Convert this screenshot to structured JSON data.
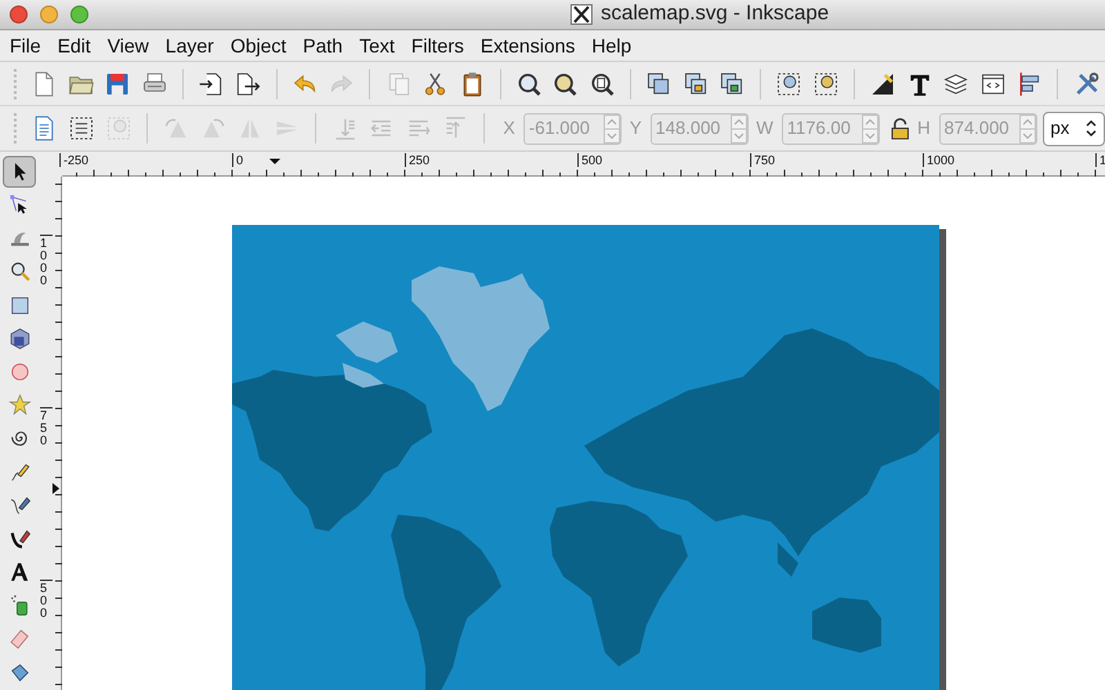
{
  "window": {
    "title": "scalemap.svg - Inkscape"
  },
  "menu": [
    {
      "label": "File"
    },
    {
      "label": "Edit"
    },
    {
      "label": "View"
    },
    {
      "label": "Layer"
    },
    {
      "label": "Object"
    },
    {
      "label": "Path"
    },
    {
      "label": "Text"
    },
    {
      "label": "Filters"
    },
    {
      "label": "Extensions"
    },
    {
      "label": "Help"
    }
  ],
  "commands_bar": [
    {
      "kind": "new",
      "disabled": false
    },
    {
      "kind": "open",
      "disabled": false
    },
    {
      "kind": "save",
      "disabled": false
    },
    {
      "kind": "print",
      "disabled": false
    },
    {
      "kind": "sep"
    },
    {
      "kind": "import",
      "disabled": false
    },
    {
      "kind": "export",
      "disabled": false
    },
    {
      "kind": "sep"
    },
    {
      "kind": "undo",
      "disabled": false
    },
    {
      "kind": "redo",
      "disabled": true
    },
    {
      "kind": "sep"
    },
    {
      "kind": "copy",
      "disabled": true
    },
    {
      "kind": "cut",
      "disabled": false
    },
    {
      "kind": "paste",
      "disabled": false
    },
    {
      "kind": "sep"
    },
    {
      "kind": "zoom-selection",
      "disabled": false
    },
    {
      "kind": "zoom-drawing",
      "disabled": false
    },
    {
      "kind": "zoom-page",
      "disabled": false
    },
    {
      "kind": "sep"
    },
    {
      "kind": "duplicate",
      "disabled": false
    },
    {
      "kind": "clone",
      "disabled": false
    },
    {
      "kind": "unlink",
      "disabled": false
    },
    {
      "kind": "sep"
    },
    {
      "kind": "group",
      "disabled": false
    },
    {
      "kind": "ungroup",
      "disabled": false
    },
    {
      "kind": "sep"
    },
    {
      "kind": "fill-stroke",
      "disabled": false
    },
    {
      "kind": "text",
      "disabled": false
    },
    {
      "kind": "layers",
      "disabled": false
    },
    {
      "kind": "xml",
      "disabled": false
    },
    {
      "kind": "align",
      "disabled": false
    },
    {
      "kind": "sep"
    },
    {
      "kind": "preferences",
      "disabled": false
    }
  ],
  "select_bar": {
    "buttons": [
      {
        "kind": "select-all",
        "disabled": false
      },
      {
        "kind": "select-all-layers",
        "disabled": false
      },
      {
        "kind": "deselect",
        "disabled": true
      },
      {
        "kind": "sep"
      },
      {
        "kind": "rotate-ccw",
        "disabled": true
      },
      {
        "kind": "rotate-cw",
        "disabled": true
      },
      {
        "kind": "flip-h",
        "disabled": true
      },
      {
        "kind": "flip-v",
        "disabled": true
      },
      {
        "kind": "sep"
      },
      {
        "kind": "to-bottom",
        "disabled": true
      },
      {
        "kind": "lower",
        "disabled": true
      },
      {
        "kind": "raise",
        "disabled": true
      },
      {
        "kind": "to-top",
        "disabled": true
      },
      {
        "kind": "sep"
      }
    ],
    "fields": [
      {
        "label": "X",
        "value": "-61.000",
        "disabled": true
      },
      {
        "label": "Y",
        "value": "148.000",
        "disabled": true
      },
      {
        "label": "W",
        "value": "1176.00",
        "disabled": true,
        "lock": true
      },
      {
        "label": "H",
        "value": "874.000",
        "disabled": true
      }
    ],
    "unit": "px"
  },
  "ruler_horizontal": [
    "-250",
    "0",
    "250",
    "500",
    "750",
    "1000",
    "1"
  ],
  "ruler_vertical": [
    "1000",
    "750",
    "500"
  ],
  "tools": [
    {
      "kind": "select",
      "selected": true
    },
    {
      "kind": "node",
      "selected": false
    },
    {
      "kind": "tweak",
      "selected": false
    },
    {
      "kind": "zoom",
      "selected": false
    },
    {
      "kind": "rect",
      "selected": false
    },
    {
      "kind": "box3d",
      "selected": false
    },
    {
      "kind": "ellipse",
      "selected": false
    },
    {
      "kind": "star",
      "selected": false
    },
    {
      "kind": "spiral",
      "selected": false
    },
    {
      "kind": "pencil",
      "selected": false
    },
    {
      "kind": "pen",
      "selected": false
    },
    {
      "kind": "calligraphy",
      "selected": false
    },
    {
      "kind": "text",
      "selected": false
    },
    {
      "kind": "spray",
      "selected": false
    },
    {
      "kind": "eraser",
      "selected": false
    },
    {
      "kind": "bucket",
      "selected": false
    }
  ]
}
